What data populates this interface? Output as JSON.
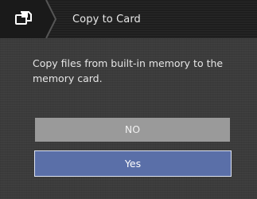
{
  "header": {
    "title": "Copy to Card",
    "icon": "copy-to-card-icon"
  },
  "dialog": {
    "message": "Copy files from built-in memory to the memory card."
  },
  "buttons": {
    "no_label": "NO",
    "yes_label": "Yes"
  },
  "colors": {
    "background": "#3b3b3b",
    "header": "#1e1e1e",
    "no_button": "#9a9a9a",
    "yes_button_selected": "#5a6fa8"
  }
}
